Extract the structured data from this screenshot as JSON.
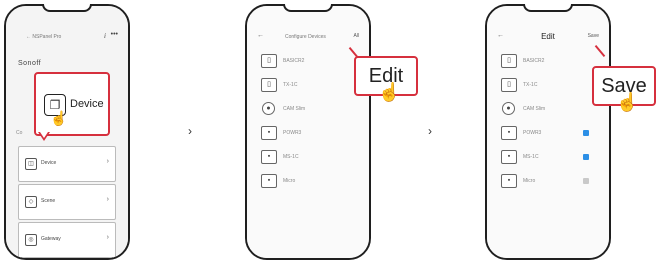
{
  "screen1": {
    "back_label": "← NSPanel Pro",
    "info_icon": "i",
    "more_icon": "•••",
    "brand": "Sonoff",
    "section_label": "Co",
    "popup_label": "Device",
    "cards": [
      {
        "label": "Device",
        "icon": "device-icon"
      },
      {
        "label": "Scene",
        "icon": "scene-icon"
      },
      {
        "label": "Gateway",
        "icon": "gateway-icon"
      }
    ]
  },
  "screen2": {
    "back_label": "←",
    "title": "Configure Devices",
    "right_label": "All",
    "devices": [
      {
        "name": "BASICR2",
        "icon": "plug-icon"
      },
      {
        "name": "TX-1C",
        "icon": "switch-icon"
      },
      {
        "name": "CAM Slim",
        "icon": "camera-icon"
      },
      {
        "name": "POWR3",
        "icon": "power-icon"
      },
      {
        "name": "MS-1C",
        "icon": "sensor-icon"
      },
      {
        "name": "Micro",
        "icon": "micro-icon"
      }
    ],
    "edit_label": "Edit"
  },
  "screen3": {
    "back_label": "←",
    "title": "Edit",
    "right_label": "Save",
    "devices": [
      {
        "name": "BASICR2",
        "icon": "plug-icon",
        "checkbox": null
      },
      {
        "name": "TX-1C",
        "icon": "switch-icon",
        "checkbox": null
      },
      {
        "name": "CAM Slim",
        "icon": "camera-icon",
        "checkbox": null
      },
      {
        "name": "POWR3",
        "icon": "power-icon",
        "checkbox": "checked"
      },
      {
        "name": "MS-1C",
        "icon": "sensor-icon",
        "checkbox": "checked"
      },
      {
        "name": "Micro",
        "icon": "micro-icon",
        "checkbox": "unchecked"
      }
    ],
    "save_label": "Save"
  },
  "arrows": [
    "›",
    "›"
  ],
  "colors": {
    "accent": "#d6303e",
    "checked": "#2c8fe6",
    "unchecked": "#c9c9c9"
  }
}
